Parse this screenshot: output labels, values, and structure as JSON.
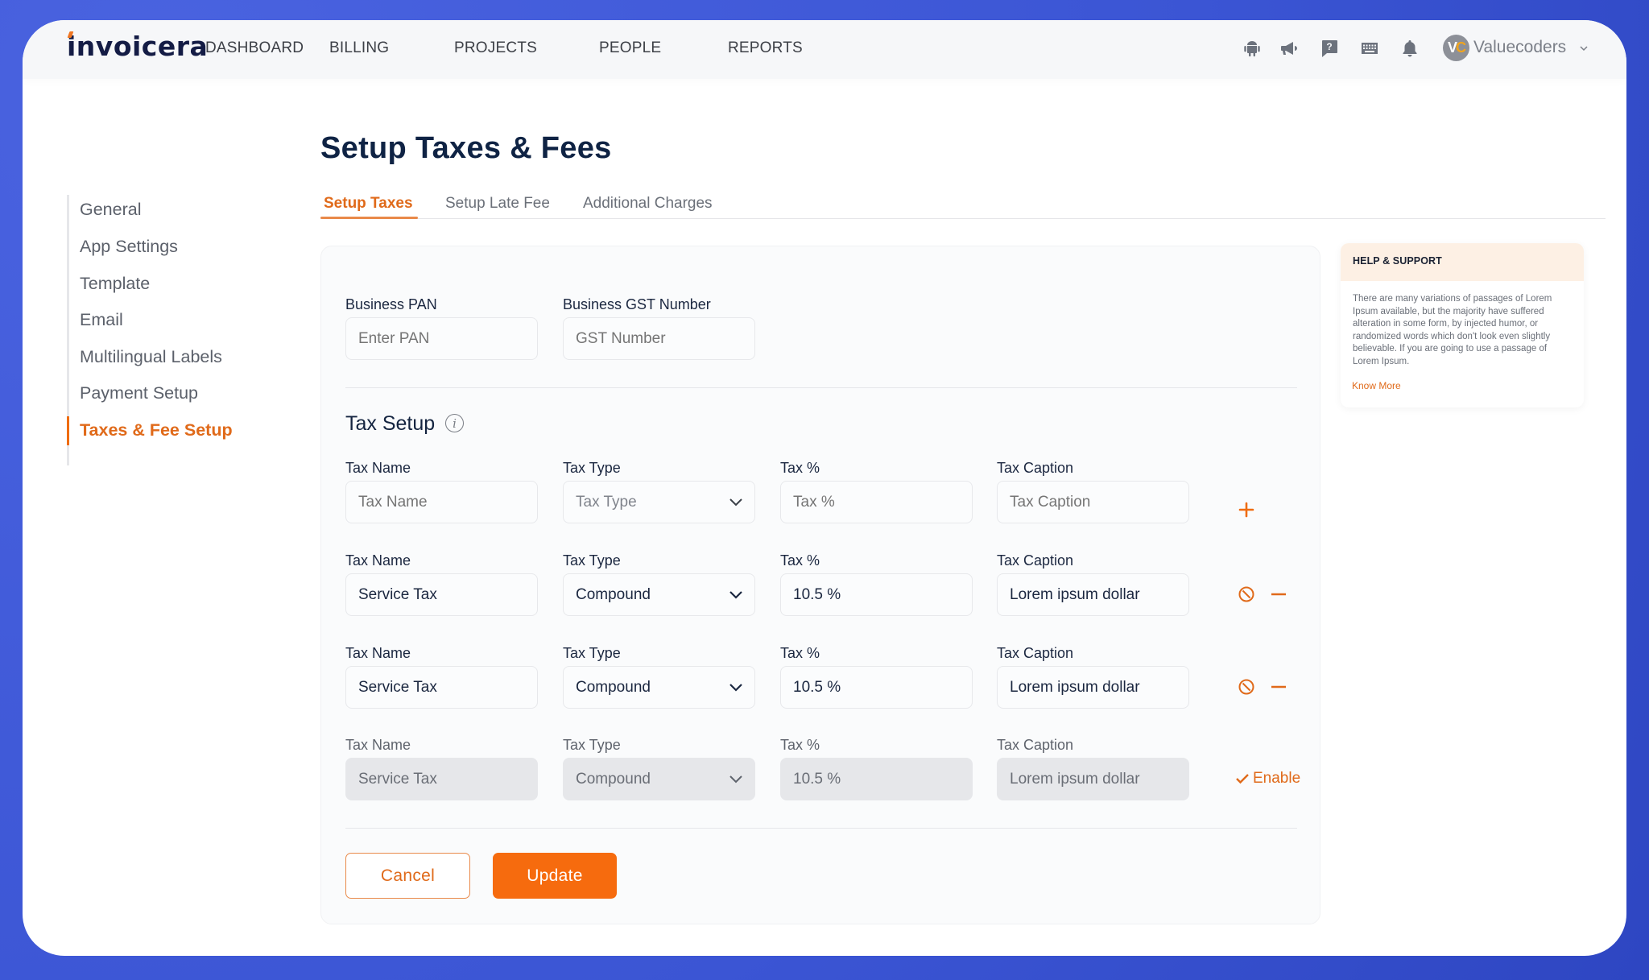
{
  "app": {
    "logo_text": "invoicera",
    "brand_color": "#F66B0E"
  },
  "nav": {
    "items": [
      {
        "label": "DASHBOARD"
      },
      {
        "label": "BILLING"
      },
      {
        "label": "PROJECTS"
      },
      {
        "label": "PEOPLE"
      },
      {
        "label": "REPORTS"
      }
    ]
  },
  "header_icons": [
    "android-icon",
    "megaphone-icon",
    "help-icon",
    "keyboard-icon",
    "bell-icon"
  ],
  "user": {
    "initials_v": "V",
    "initials_c": "C",
    "name": "Valuecoders"
  },
  "sidebar": {
    "items": [
      {
        "label": "General",
        "active": false
      },
      {
        "label": "App Settings",
        "active": false
      },
      {
        "label": "Template",
        "active": false
      },
      {
        "label": "Email",
        "active": false
      },
      {
        "label": "Multilingual Labels",
        "active": false
      },
      {
        "label": "Payment Setup",
        "active": false
      },
      {
        "label": "Taxes & Fee Setup",
        "active": true
      }
    ]
  },
  "page": {
    "title": "Setup Taxes & Fees",
    "tabs": [
      {
        "label": "Setup Taxes",
        "active": true
      },
      {
        "label": "Setup Late Fee",
        "active": false
      },
      {
        "label": "Additional Charges",
        "active": false
      }
    ]
  },
  "business": {
    "pan_label": "Business PAN",
    "pan_placeholder": "Enter PAN",
    "pan_value": "",
    "gst_label": "Business GST Number",
    "gst_placeholder": "GST Number",
    "gst_value": ""
  },
  "tax_setup": {
    "title": "Tax Setup",
    "info_glyph": "i",
    "column_labels": {
      "name": "Tax Name",
      "type": "Tax Type",
      "percent": "Tax %",
      "caption": "Tax Caption"
    },
    "rows": [
      {
        "state": "new",
        "name": "",
        "type": "",
        "percent": "",
        "caption": "",
        "name_placeholder": "Tax Name",
        "type_placeholder": "Tax Type",
        "percent_placeholder": "Tax %",
        "caption_placeholder": "Tax Caption",
        "actions": [
          "add"
        ]
      },
      {
        "state": "active",
        "name": "Service Tax",
        "type": "Compound",
        "percent": "10.5 %",
        "caption": "Lorem ipsum dollar",
        "actions": [
          "disable",
          "remove"
        ]
      },
      {
        "state": "active",
        "name": "Service Tax",
        "type": "Compound",
        "percent": "10.5 %",
        "caption": "Lorem ipsum dollar",
        "actions": [
          "disable",
          "remove"
        ]
      },
      {
        "state": "disabled",
        "name": "Service Tax",
        "type": "Compound",
        "percent": "10.5 %",
        "caption": "Lorem ipsum dollar",
        "actions": [
          "enable"
        ],
        "enable_label": "Enable"
      }
    ]
  },
  "buttons": {
    "cancel": "Cancel",
    "update": "Update"
  },
  "help": {
    "title": "HELP & SUPPORT",
    "body": "There are many variations of passages of Lorem Ipsum available, but the majority have suffered alteration in some form, by injected humor, or randomized words which don't look even slightly believable. If you are going to use a passage of Lorem Ipsum.",
    "link": "Know More"
  }
}
